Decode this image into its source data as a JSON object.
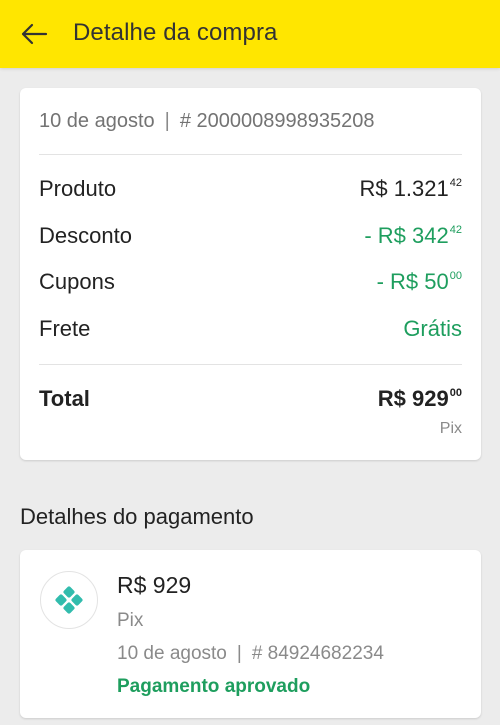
{
  "header": {
    "title": "Detalhe da compra",
    "back_icon": "arrow-left-icon"
  },
  "order": {
    "date": "10 de agosto",
    "separator": "|",
    "number": "# 2000008998935208"
  },
  "summary": {
    "rows": [
      {
        "label": "Produto",
        "value_main": "R$ 1.321",
        "value_cents": "42"
      },
      {
        "label": "Desconto",
        "value_main": "- R$ 342",
        "value_cents": "42"
      },
      {
        "label": "Cupons",
        "value_main": "- R$ 50",
        "value_cents": "00"
      },
      {
        "label": "Frete",
        "value_main": "Grátis",
        "value_cents": ""
      }
    ],
    "total": {
      "label": "Total",
      "value_main": "R$ 929",
      "value_cents": "00",
      "method": "Pix"
    }
  },
  "payment": {
    "section_title": "Detalhes do pagamento",
    "icon": "pix-icon",
    "amount": "R$ 929",
    "method": "Pix",
    "date": "10 de agosto",
    "separator": "|",
    "transaction": "# 84924682234",
    "status": "Pagamento aprovado"
  },
  "colors": {
    "appbar": "#ffe600",
    "positive": "#1e9e5e",
    "pix": "#32bcad"
  }
}
